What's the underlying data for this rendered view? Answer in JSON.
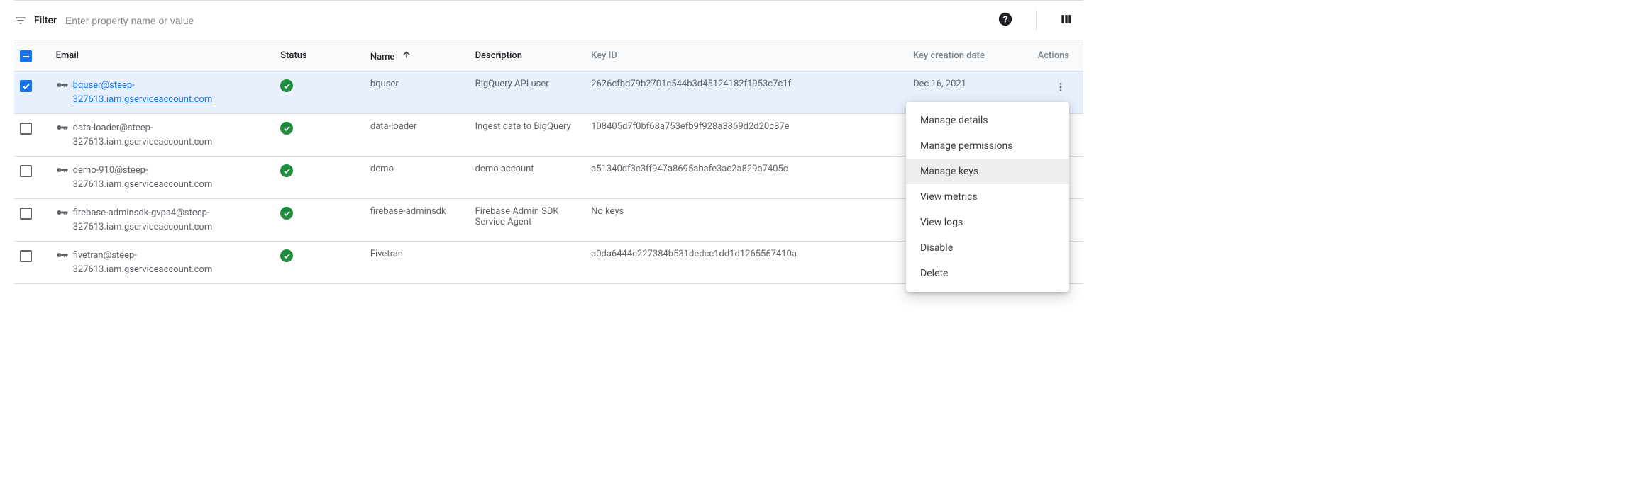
{
  "filter": {
    "label": "Filter",
    "placeholder": "Enter property name or value"
  },
  "columns": {
    "email": "Email",
    "status": "Status",
    "name": "Name",
    "description": "Description",
    "keyid": "Key ID",
    "keydate": "Key creation date",
    "actions": "Actions"
  },
  "rows": [
    {
      "email": "bquser@steep-327613.iam.gserviceaccount.com",
      "name": "bquser",
      "description": "BigQuery API user",
      "keyid": "2626cfbd79b2701c544b3d45124182f1953c7c1f",
      "keydate": "Dec 16, 2021",
      "selected": true,
      "link": true
    },
    {
      "email": "data-loader@steep-327613.iam.gserviceaccount.com",
      "name": "data-loader",
      "description": "Ingest data to BigQuery",
      "keyid": "108405d7f0bf68a753efb9f928a3869d2d20c87e",
      "keydate": "",
      "selected": false
    },
    {
      "email": "demo-910@steep-327613.iam.gserviceaccount.com",
      "name": "demo",
      "description": "demo account",
      "keyid": "a51340df3c3ff947a8695abafe3ac2a829a7405c",
      "keydate": "",
      "selected": false
    },
    {
      "email": "firebase-adminsdk-gvpa4@steep-327613.iam.gserviceaccount.com",
      "name": "firebase-adminsdk",
      "description": "Firebase Admin SDK Service Agent",
      "keyid": "No keys",
      "keydate": "",
      "selected": false
    },
    {
      "email": "fivetran@steep-327613.iam.gserviceaccount.com",
      "name": "Fivetran",
      "description": "",
      "keyid": "a0da6444c227384b531dedcc1dd1d1265567410a",
      "keydate": "",
      "selected": false
    }
  ],
  "menu": {
    "manage_details": "Manage details",
    "manage_permissions": "Manage permissions",
    "manage_keys": "Manage keys",
    "view_metrics": "View metrics",
    "view_logs": "View logs",
    "disable": "Disable",
    "delete": "Delete"
  }
}
